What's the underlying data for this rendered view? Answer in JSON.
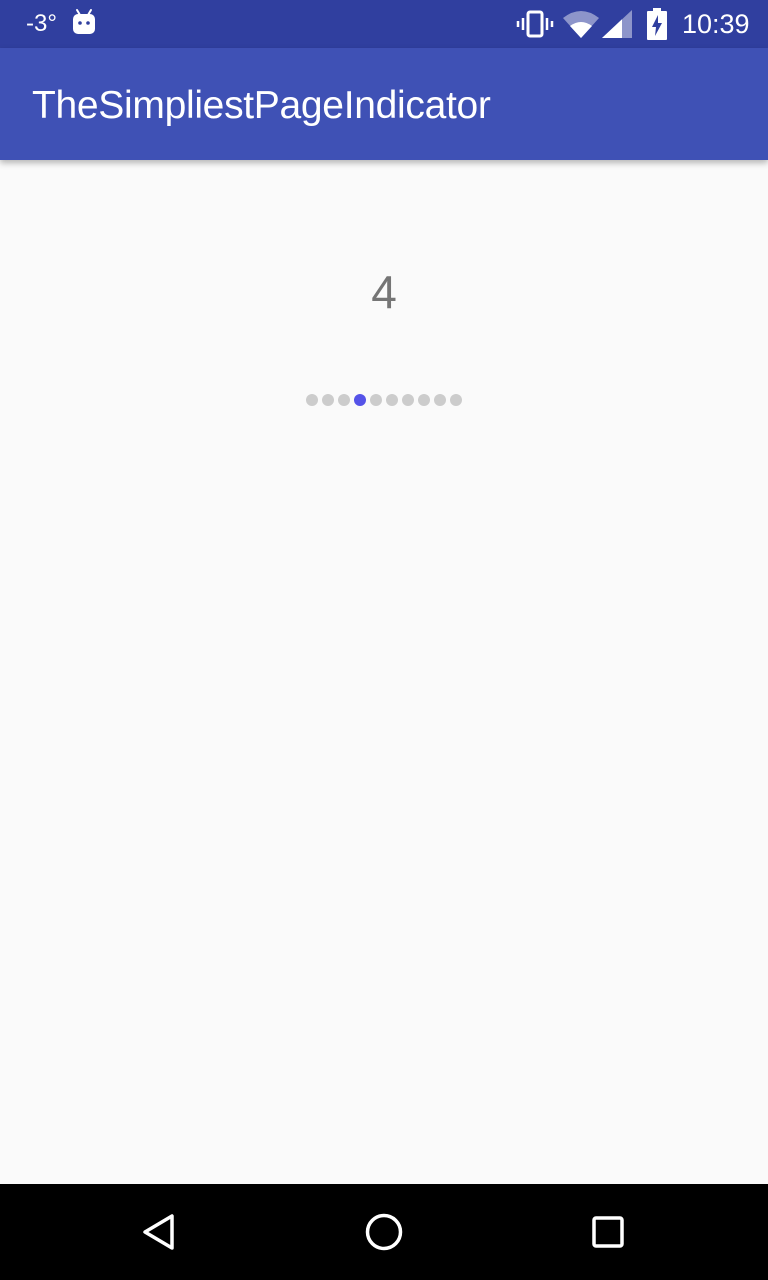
{
  "status_bar": {
    "temperature": "-3°",
    "time": "10:39",
    "icons": [
      "android-icon",
      "vibrate-icon",
      "wifi-icon",
      "signal-icon",
      "battery-charging-icon"
    ]
  },
  "app_bar": {
    "title": "TheSimpliestPageIndicator"
  },
  "main": {
    "page_number": "4",
    "indicator": {
      "total_pages": 10,
      "active_page": 4,
      "active_color": "#5553e8",
      "inactive_color": "#cccccc"
    }
  },
  "nav_bar": {
    "buttons": [
      "back-icon",
      "home-icon",
      "recents-icon"
    ]
  },
  "colors": {
    "status_bar": "#303f9f",
    "app_bar": "#3f51b5",
    "background": "#fafafa",
    "page_number_text": "#757575"
  }
}
